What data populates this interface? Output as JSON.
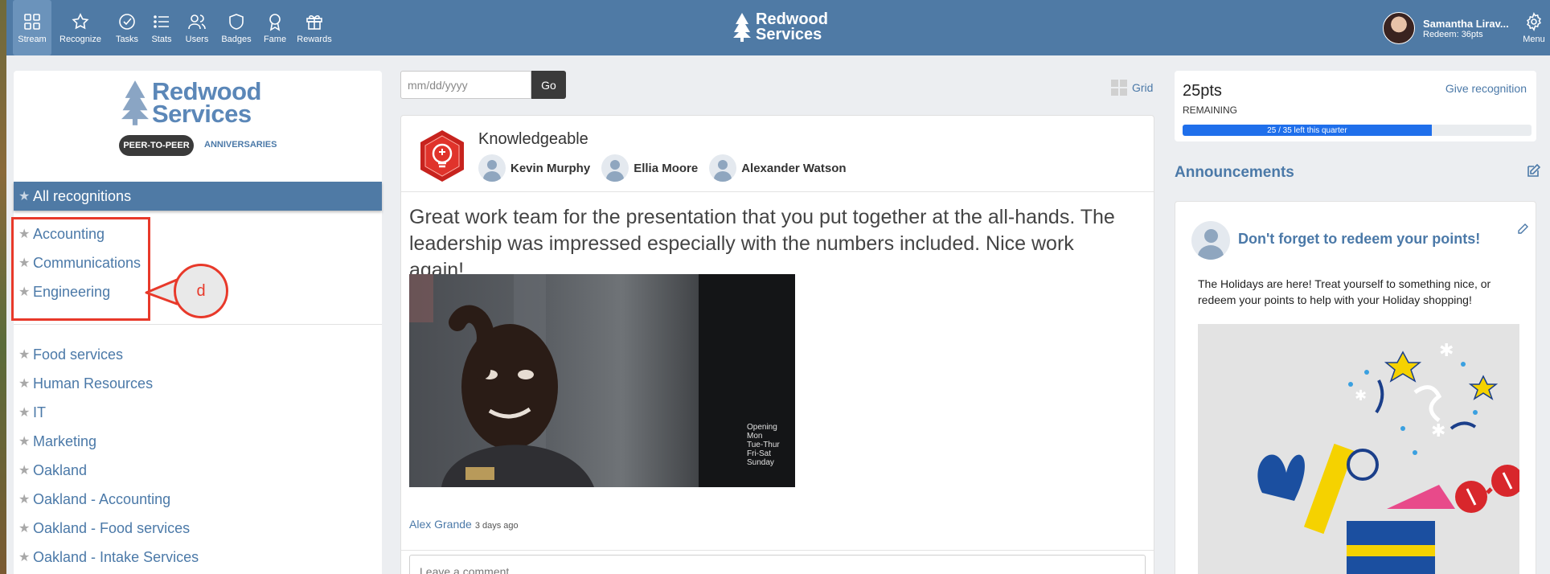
{
  "topbar": {
    "nav": [
      {
        "label": "Stream",
        "icon": "stream-grid-icon",
        "active": true
      },
      {
        "label": "Recognize",
        "icon": "star-icon"
      },
      {
        "label": "Tasks",
        "icon": "check-circle-icon"
      },
      {
        "label": "Stats",
        "icon": "list-icon"
      },
      {
        "label": "Users",
        "icon": "users-icon"
      },
      {
        "label": "Badges",
        "icon": "shield-icon"
      },
      {
        "label": "Fame",
        "icon": "award-ribbon-icon"
      },
      {
        "label": "Rewards",
        "icon": "gift-icon"
      }
    ],
    "brand": {
      "line1": "Redwood",
      "line2": "Services"
    },
    "user": {
      "name": "Samantha Lirav...",
      "redeem": "Redeem: 36pts"
    },
    "menu_label": "Menu",
    "colors": {
      "bar": "#4f7aa5",
      "active": "#6b93bb"
    }
  },
  "sidebar": {
    "brand": {
      "line1": "Redwood",
      "line2": "Services"
    },
    "tabs": {
      "active": "PEER-TO-PEER",
      "other": "ANNIVERSARIES"
    },
    "all_label": "All recognitions",
    "group1": [
      "Accounting",
      "Communications",
      "Engineering"
    ],
    "group2": [
      "Food services",
      "Human Resources",
      "IT",
      "Marketing",
      "Oakland",
      "Oakland - Accounting",
      "Oakland - Food services",
      "Oakland - Intake Services"
    ],
    "annotation_label": "d"
  },
  "feed": {
    "date_placeholder": "mm/dd/yyyy",
    "go_label": "Go",
    "grid_label": "Grid",
    "post": {
      "badge": "Knowledgeable",
      "recipients": [
        "Kevin Murphy",
        "Ellia Moore",
        "Alexander Watson"
      ],
      "message": "Great work team for the presentation that you put together at the all-hands. The leadership was impressed especially with the numbers included. Nice work again!",
      "author": "Alex Grande",
      "time": "3 days ago",
      "comment_placeholder": "Leave a comment",
      "photo_sign": [
        "Opening",
        "Mon",
        "Tue-Thur",
        "Fri-Sat",
        "Sunday"
      ]
    }
  },
  "points": {
    "value": "25pts",
    "sub": "REMAINING",
    "give_label": "Give recognition",
    "progress_text": "25 / 35 left this quarter",
    "progress_fraction": 0.714
  },
  "announcements": {
    "title": "Announcements",
    "heading": "Don't forget to redeem your points!",
    "body": "The Holidays are here! Treat yourself to something nice, or redeem your points to help with your Holiday shopping!"
  }
}
